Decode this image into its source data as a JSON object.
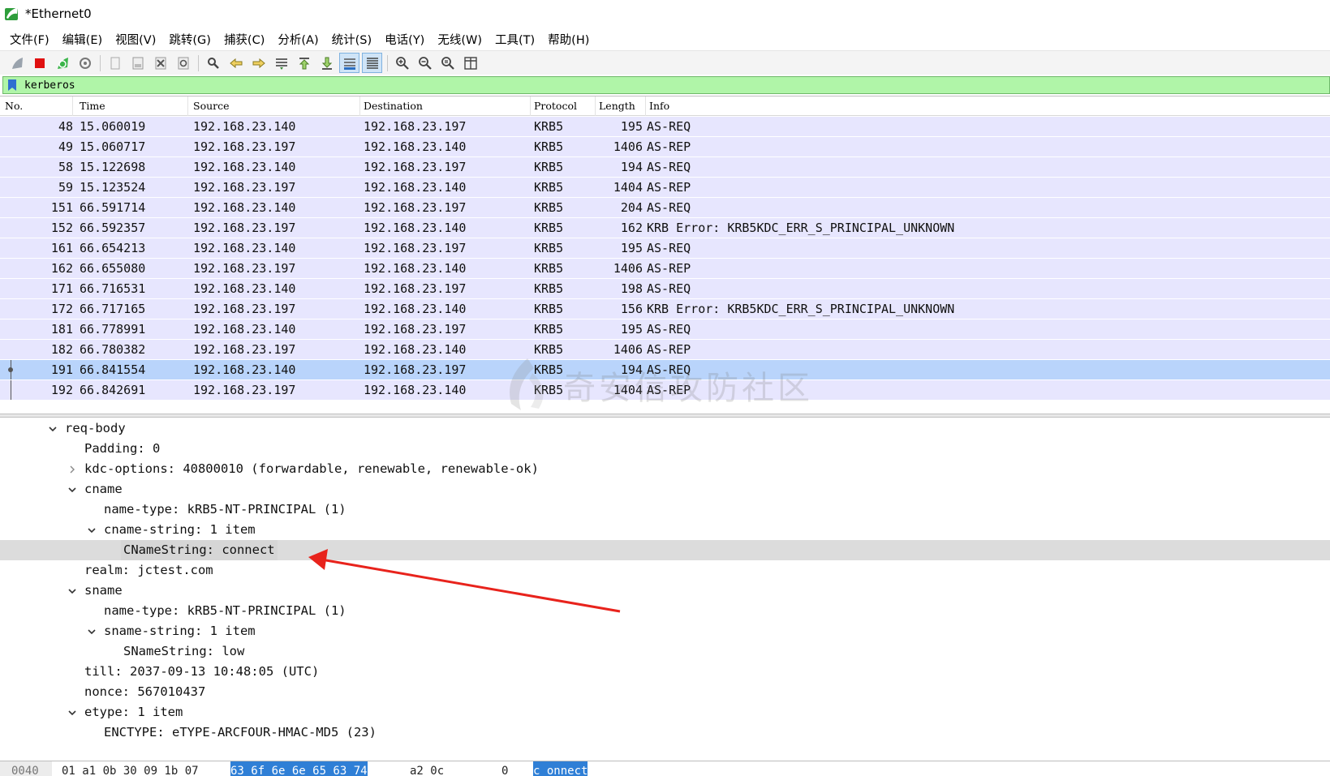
{
  "window": {
    "title": "*Ethernet0"
  },
  "menu": [
    "文件(F)",
    "编辑(E)",
    "视图(V)",
    "跳转(G)",
    "捕获(C)",
    "分析(A)",
    "统计(S)",
    "电话(Y)",
    "无线(W)",
    "工具(T)",
    "帮助(H)"
  ],
  "toolbar": {
    "buttons": [
      "shark-fin-start-icon",
      "stop-capture-icon",
      "restart-capture-icon",
      "capture-options-icon",
      "open-file-icon",
      "save-file-icon",
      "close-file-icon",
      "reload-file-icon",
      "find-packet-icon",
      "go-back-icon",
      "go-forward-icon",
      "go-to-packet-icon",
      "go-first-packet-icon",
      "go-last-packet-icon",
      "auto-scroll-icon",
      "colorize-icon",
      "zoom-in-icon",
      "zoom-out-icon",
      "normal-size-icon",
      "resize-columns-icon"
    ]
  },
  "filter": {
    "value": "kerberos",
    "bg_color": "#b0f5a8"
  },
  "packet_list": {
    "columns": [
      "No.",
      "Time",
      "Source",
      "Destination",
      "Protocol",
      "Length",
      "Info"
    ],
    "rows": [
      {
        "no": "48",
        "time": "15.060019",
        "src": "192.168.23.140",
        "dst": "192.168.23.197",
        "proto": "KRB5",
        "len": "195",
        "info": "AS-REQ"
      },
      {
        "no": "49",
        "time": "15.060717",
        "src": "192.168.23.197",
        "dst": "192.168.23.140",
        "proto": "KRB5",
        "len": "1406",
        "info": "AS-REP"
      },
      {
        "no": "58",
        "time": "15.122698",
        "src": "192.168.23.140",
        "dst": "192.168.23.197",
        "proto": "KRB5",
        "len": "194",
        "info": "AS-REQ"
      },
      {
        "no": "59",
        "time": "15.123524",
        "src": "192.168.23.197",
        "dst": "192.168.23.140",
        "proto": "KRB5",
        "len": "1404",
        "info": "AS-REP"
      },
      {
        "no": "151",
        "time": "66.591714",
        "src": "192.168.23.140",
        "dst": "192.168.23.197",
        "proto": "KRB5",
        "len": "204",
        "info": "AS-REQ"
      },
      {
        "no": "152",
        "time": "66.592357",
        "src": "192.168.23.197",
        "dst": "192.168.23.140",
        "proto": "KRB5",
        "len": "162",
        "info": "KRB Error: KRB5KDC_ERR_S_PRINCIPAL_UNKNOWN"
      },
      {
        "no": "161",
        "time": "66.654213",
        "src": "192.168.23.140",
        "dst": "192.168.23.197",
        "proto": "KRB5",
        "len": "195",
        "info": "AS-REQ"
      },
      {
        "no": "162",
        "time": "66.655080",
        "src": "192.168.23.197",
        "dst": "192.168.23.140",
        "proto": "KRB5",
        "len": "1406",
        "info": "AS-REP"
      },
      {
        "no": "171",
        "time": "66.716531",
        "src": "192.168.23.140",
        "dst": "192.168.23.197",
        "proto": "KRB5",
        "len": "198",
        "info": "AS-REQ"
      },
      {
        "no": "172",
        "time": "66.717165",
        "src": "192.168.23.197",
        "dst": "192.168.23.140",
        "proto": "KRB5",
        "len": "156",
        "info": "KRB Error: KRB5KDC_ERR_S_PRINCIPAL_UNKNOWN"
      },
      {
        "no": "181",
        "time": "66.778991",
        "src": "192.168.23.140",
        "dst": "192.168.23.197",
        "proto": "KRB5",
        "len": "195",
        "info": "AS-REQ"
      },
      {
        "no": "182",
        "time": "66.780382",
        "src": "192.168.23.197",
        "dst": "192.168.23.140",
        "proto": "KRB5",
        "len": "1406",
        "info": "AS-REP"
      },
      {
        "no": "191",
        "time": "66.841554",
        "src": "192.168.23.140",
        "dst": "192.168.23.197",
        "proto": "KRB5",
        "len": "194",
        "info": "AS-REQ",
        "selected": true
      },
      {
        "no": "192",
        "time": "66.842691",
        "src": "192.168.23.197",
        "dst": "192.168.23.140",
        "proto": "KRB5",
        "len": "1404",
        "info": "AS-REP"
      }
    ]
  },
  "details": [
    {
      "text": "req-body",
      "toggle": "expanded",
      "depth": 0
    },
    {
      "text": "Padding: 0",
      "toggle": "none",
      "depth": 1
    },
    {
      "text": "kdc-options: 40800010 (forwardable, renewable, renewable-ok)",
      "toggle": "collapsed",
      "depth": 1
    },
    {
      "text": "cname",
      "toggle": "expanded",
      "depth": 1
    },
    {
      "text": "name-type: kRB5-NT-PRINCIPAL (1)",
      "toggle": "none",
      "depth": 2
    },
    {
      "text": "cname-string: 1 item",
      "toggle": "expanded",
      "depth": 2
    },
    {
      "text": "CNameString: connect",
      "toggle": "none",
      "depth": 3,
      "highlighted": true
    },
    {
      "text": "realm: jctest.com",
      "toggle": "none",
      "depth": 1
    },
    {
      "text": "sname",
      "toggle": "expanded",
      "depth": 1
    },
    {
      "text": "name-type: kRB5-NT-PRINCIPAL (1)",
      "toggle": "none",
      "depth": 2
    },
    {
      "text": "sname-string: 1 item",
      "toggle": "expanded",
      "depth": 2
    },
    {
      "text": "SNameString: low",
      "toggle": "none",
      "depth": 3
    },
    {
      "text": "till: 2037-09-13 10:48:05 (UTC)",
      "toggle": "none",
      "depth": 1
    },
    {
      "text": "nonce: 567010437",
      "toggle": "none",
      "depth": 1
    },
    {
      "text": "etype: 1 item",
      "toggle": "expanded",
      "depth": 1
    },
    {
      "text": "ENCTYPE: eTYPE-ARCFOUR-HMAC-MD5 (23)",
      "toggle": "none",
      "depth": 2
    }
  ],
  "bytes": {
    "offset": "0040",
    "hex_before": "01 a1 0b 30 09 1b 07",
    "hex_selected": "63  6f 6e 6e 65 63 74",
    "hex_after": "a2 0c",
    "ascii_before": "0",
    "ascii_selected": "c onnect"
  },
  "watermark": {
    "text": "奇安信攻防社区"
  },
  "colors": {
    "row_bg": "#e7e6fe",
    "selected_row_bg": "#b9d4fb",
    "arrow": "#e8231c"
  }
}
